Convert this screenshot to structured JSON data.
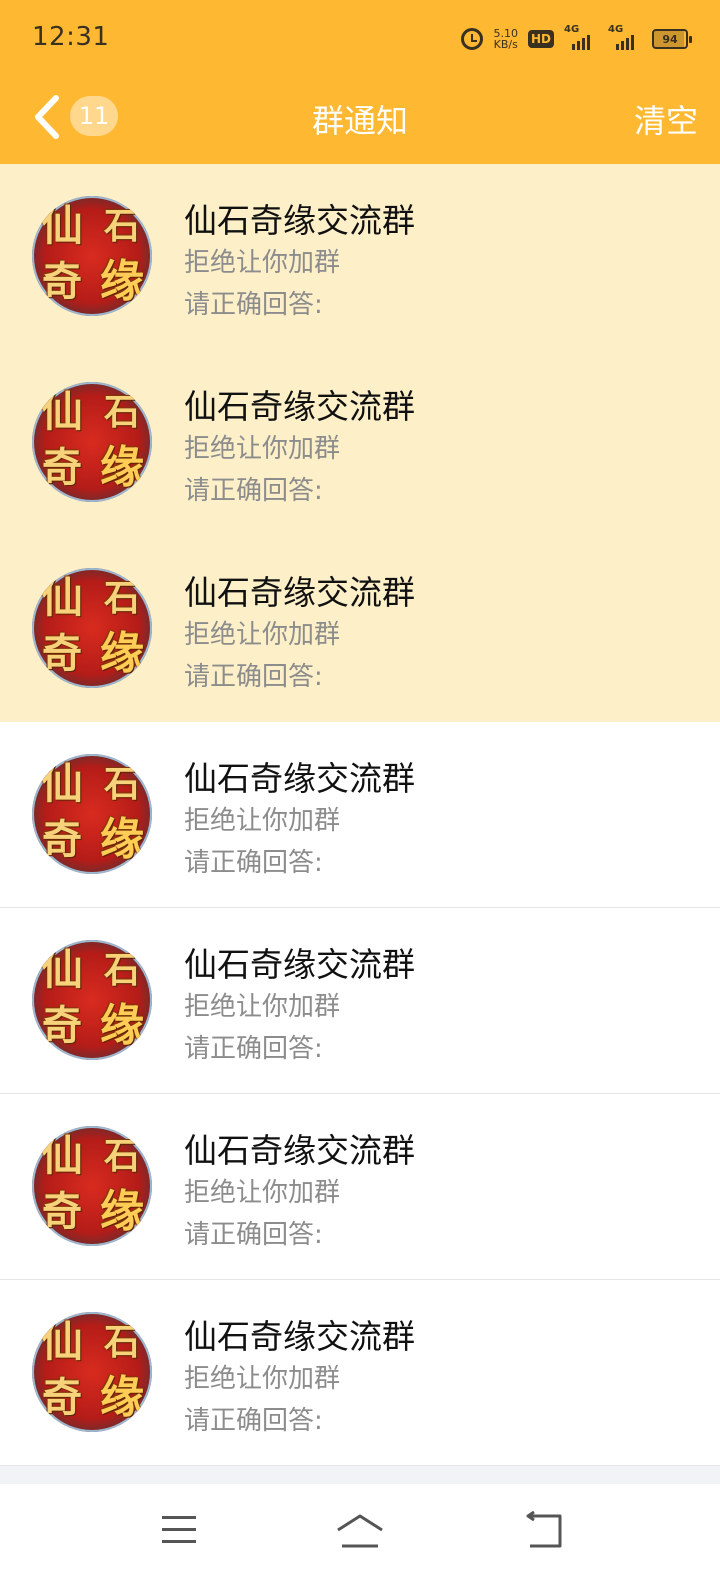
{
  "status_bar": {
    "time": "12:31",
    "speed_value": "5.10",
    "speed_unit": "KB/s",
    "hd_label": "HD",
    "sim1_label": "4G",
    "sim2_label": "4G",
    "battery_level": "94"
  },
  "nav": {
    "back_badge": "11",
    "title": "群通知",
    "clear_label": "清空"
  },
  "avatar_glyphs": [
    "仙",
    "石",
    "奇",
    "缘"
  ],
  "notifications": [
    {
      "group": "仙石奇缘交流群",
      "status": "拒绝让你加群",
      "answer": "请正确回答:",
      "unread": true
    },
    {
      "group": "仙石奇缘交流群",
      "status": "拒绝让你加群",
      "answer": "请正确回答:",
      "unread": true
    },
    {
      "group": "仙石奇缘交流群",
      "status": "拒绝让你加群",
      "answer": "请正确回答:",
      "unread": true
    },
    {
      "group": "仙石奇缘交流群",
      "status": "拒绝让你加群",
      "answer": "请正确回答:",
      "unread": false
    },
    {
      "group": "仙石奇缘交流群",
      "status": "拒绝让你加群",
      "answer": "请正确回答:",
      "unread": false
    },
    {
      "group": "仙石奇缘交流群",
      "status": "拒绝让你加群",
      "answer": "请正确回答:",
      "unread": false
    },
    {
      "group": "仙石奇缘交流群",
      "status": "拒绝让你加群",
      "answer": "请正确回答:",
      "unread": false
    }
  ],
  "colors": {
    "header": "#FFB832",
    "unread_row": "#FDF0C9",
    "read_row": "#FFFFFF"
  },
  "system_nav": {
    "menu_icon": "menu-icon",
    "home_icon": "home-icon",
    "back_icon": "back-icon"
  }
}
